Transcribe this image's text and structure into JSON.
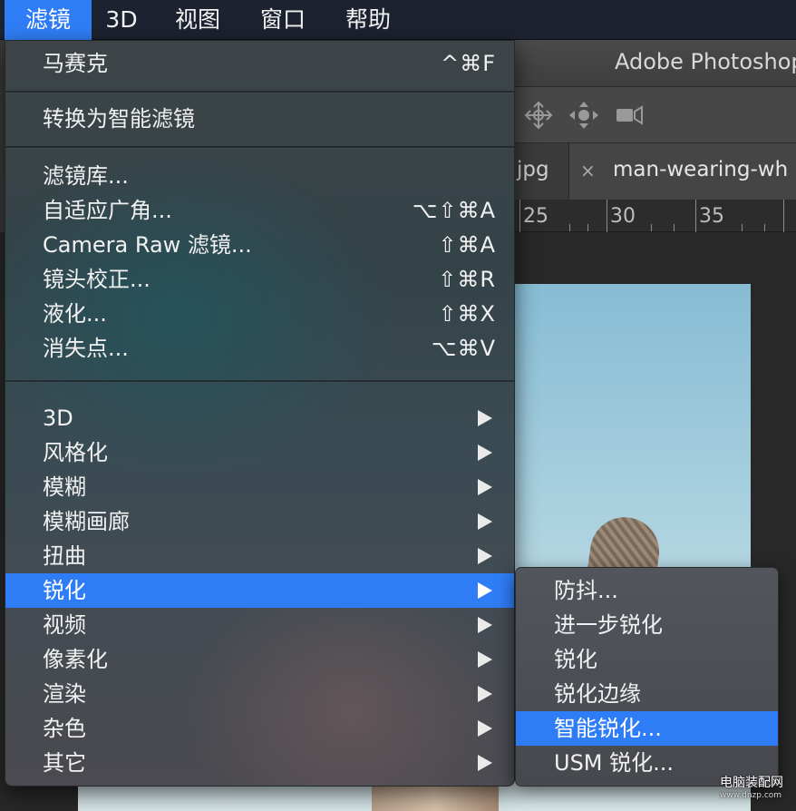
{
  "menubar": {
    "items": [
      {
        "label": "滤镜",
        "active": true
      },
      {
        "label": "3D",
        "active": false
      },
      {
        "label": "视图",
        "active": false
      },
      {
        "label": "窗口",
        "active": false
      },
      {
        "label": "帮助",
        "active": false
      }
    ]
  },
  "photoshop": {
    "title": "Adobe Photoshop",
    "tabs": {
      "prev_tab_label": "jpg",
      "active_tab_close": "×",
      "active_tab_label": "man-wearing-wh"
    },
    "ruler_labels": [
      "25",
      "30",
      "35"
    ]
  },
  "filter_menu": {
    "last_filter": {
      "label": "马赛克",
      "shortcut": "^⌘F"
    },
    "convert_smart": {
      "label": "转换为智能滤镜"
    },
    "group_tools": [
      {
        "label": "滤镜库...",
        "shortcut": ""
      },
      {
        "label": "自适应广角...",
        "shortcut": "⌥⇧⌘A"
      },
      {
        "label": "Camera Raw 滤镜...",
        "shortcut": "⇧⌘A"
      },
      {
        "label": "镜头校正...",
        "shortcut": "⇧⌘R"
      },
      {
        "label": "液化...",
        "shortcut": "⇧⌘X"
      },
      {
        "label": "消失点...",
        "shortcut": "⌥⌘V"
      }
    ],
    "submenus": [
      {
        "label": "3D",
        "highlighted": false
      },
      {
        "label": "风格化",
        "highlighted": false
      },
      {
        "label": "模糊",
        "highlighted": false
      },
      {
        "label": "模糊画廊",
        "highlighted": false
      },
      {
        "label": "扭曲",
        "highlighted": false
      },
      {
        "label": "锐化",
        "highlighted": true
      },
      {
        "label": "视频",
        "highlighted": false
      },
      {
        "label": "像素化",
        "highlighted": false
      },
      {
        "label": "渲染",
        "highlighted": false
      },
      {
        "label": "杂色",
        "highlighted": false
      },
      {
        "label": "其它",
        "highlighted": false
      }
    ]
  },
  "sharpen_submenu": {
    "items": [
      {
        "label": "防抖...",
        "highlighted": false
      },
      {
        "label": "进一步锐化",
        "highlighted": false
      },
      {
        "label": "锐化",
        "highlighted": false
      },
      {
        "label": "锐化边缘",
        "highlighted": false
      },
      {
        "label": "智能锐化...",
        "highlighted": true
      },
      {
        "label": "USM 锐化...",
        "highlighted": false
      }
    ]
  },
  "watermark": {
    "text": "电脑装配网",
    "url": "www.dnzp.com"
  },
  "colors": {
    "highlight": "#2f7df6",
    "menubar": "#1d2230"
  }
}
